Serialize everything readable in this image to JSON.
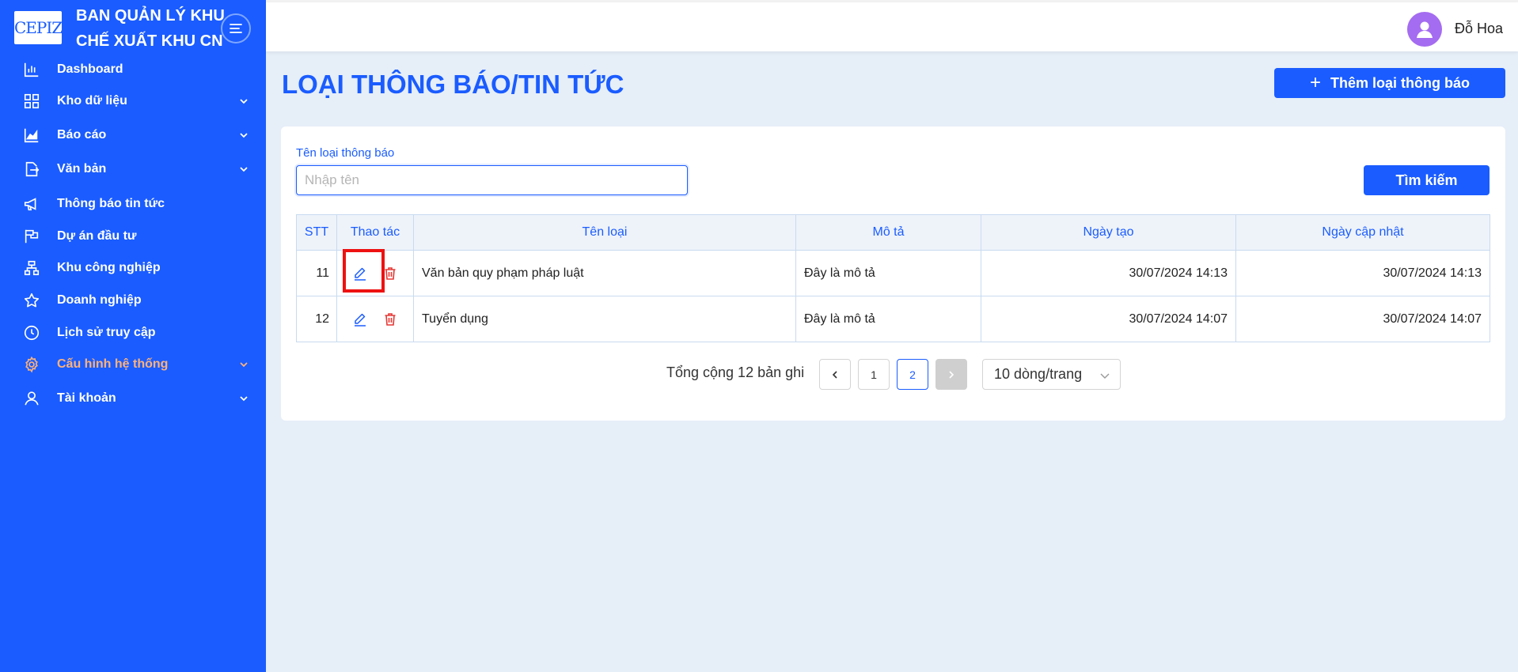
{
  "brand": {
    "logo_text": "CEPIZA",
    "title_line1": "BAN QUẢN LÝ KHU",
    "title_line2": "CHẾ XUẤT KHU CN"
  },
  "sidebar": {
    "items": [
      {
        "label": "Dashboard",
        "icon": "bar-chart-icon",
        "has_submenu": false
      },
      {
        "label": "Kho dữ liệu",
        "icon": "grid-icon",
        "has_submenu": true
      },
      {
        "label": "Báo cáo",
        "icon": "area-chart-icon",
        "has_submenu": true
      },
      {
        "label": "Văn bản",
        "icon": "document-export-icon",
        "has_submenu": true
      },
      {
        "label": "Thông báo tin tức",
        "icon": "megaphone-icon",
        "has_submenu": false
      },
      {
        "label": "Dự án đầu tư",
        "icon": "flag-icon",
        "has_submenu": false
      },
      {
        "label": "Khu công nghiệp",
        "icon": "cluster-icon",
        "has_submenu": false
      },
      {
        "label": "Doanh nghiệp",
        "icon": "star-icon",
        "has_submenu": false
      },
      {
        "label": "Lịch sử truy cập",
        "icon": "clock-icon",
        "has_submenu": false
      },
      {
        "label": "Cấu hình hệ thống",
        "icon": "gear-icon",
        "has_submenu": true,
        "active": true
      },
      {
        "label": "Tài khoản",
        "icon": "user-icon",
        "has_submenu": true
      }
    ]
  },
  "header": {
    "username": "Đỗ Hoa"
  },
  "page": {
    "title": "LOẠI THÔNG BÁO/TIN TỨC",
    "add_button_label": "Thêm loại thông báo"
  },
  "filter": {
    "label": "Tên loại thông báo",
    "placeholder": "Nhập tên",
    "value": "",
    "search_button_label": "Tìm kiếm"
  },
  "table": {
    "columns": [
      "STT",
      "Thao tác",
      "Tên loại",
      "Mô tả",
      "Ngày tạo",
      "Ngày cập nhật"
    ],
    "rows": [
      {
        "stt": "11",
        "name": "Văn bản quy phạm pháp luật",
        "description": "Đây là mô tả",
        "created": "30/07/2024 14:13",
        "updated": "30/07/2024 14:13"
      },
      {
        "stt": "12",
        "name": "Tuyển dụng",
        "description": "Đây là mô tả",
        "created": "30/07/2024 14:07",
        "updated": "30/07/2024 14:07"
      }
    ]
  },
  "pagination": {
    "total_text": "Tổng cộng 12 bản ghi",
    "pages": [
      "1",
      "2"
    ],
    "current_page": "2",
    "page_size_label": "10 dòng/trang"
  },
  "colors": {
    "primary": "#1a5cff",
    "active_menu": "#ffb27a",
    "delete": "#e53935",
    "highlight": "#ee1111",
    "avatar": "#a46cf0"
  }
}
